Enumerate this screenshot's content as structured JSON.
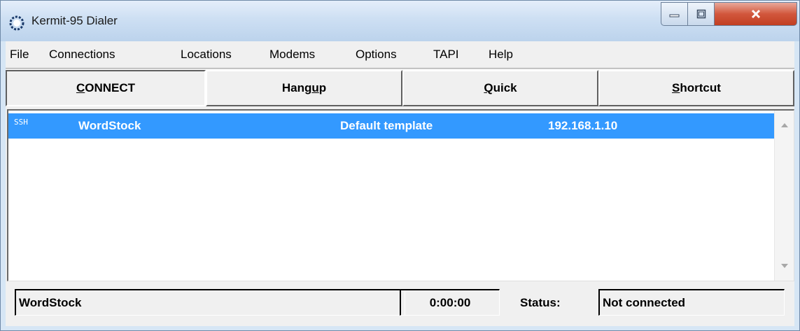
{
  "window": {
    "title": "Kermit-95 Dialer"
  },
  "menu": [
    "File",
    "Connections",
    "Locations",
    "Modems",
    "Options",
    "TAPI",
    "Help"
  ],
  "toolbar": {
    "connect": {
      "underline": "C",
      "rest": "ONNECT"
    },
    "hangup": {
      "pre": "Hang",
      "underline": "u",
      "rest": "p"
    },
    "quick": {
      "underline": "Q",
      "rest": "uick"
    },
    "shortcut": {
      "underline": "S",
      "rest": "hortcut"
    }
  },
  "list": {
    "rows": [
      {
        "type": "SSH",
        "name": "WordStock",
        "template": "Default template",
        "host": "192.168.1.10",
        "selected": true
      }
    ]
  },
  "status": {
    "entry": "WordStock",
    "elapsed": "0:00:00",
    "label": "Status:",
    "state": "Not connected"
  },
  "colors": {
    "selection": "#3399ff",
    "close": "#c13e22"
  }
}
